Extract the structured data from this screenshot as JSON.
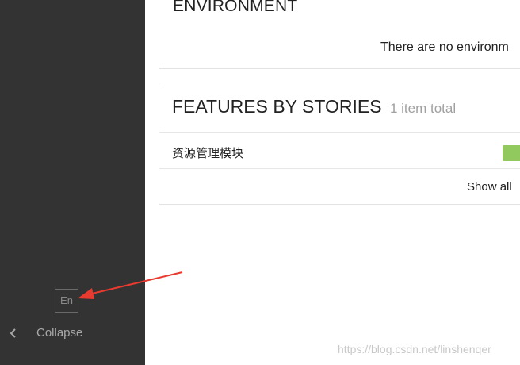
{
  "sidebar": {
    "lang_button": "En",
    "collapse_label": "Collapse"
  },
  "environment": {
    "title": "ENVIRONMENT",
    "empty_text": "There are no environm"
  },
  "features": {
    "title": "FEATURES BY STORIES",
    "count": "1 item total",
    "rows": [
      {
        "label": "资源管理模块"
      }
    ],
    "show_all": "Show all"
  },
  "watermark": "https://blog.csdn.net/linshenqer",
  "colors": {
    "sidebar_bg": "#333333",
    "bar_green": "#92c95e",
    "arrow_red": "#e83a2f"
  }
}
